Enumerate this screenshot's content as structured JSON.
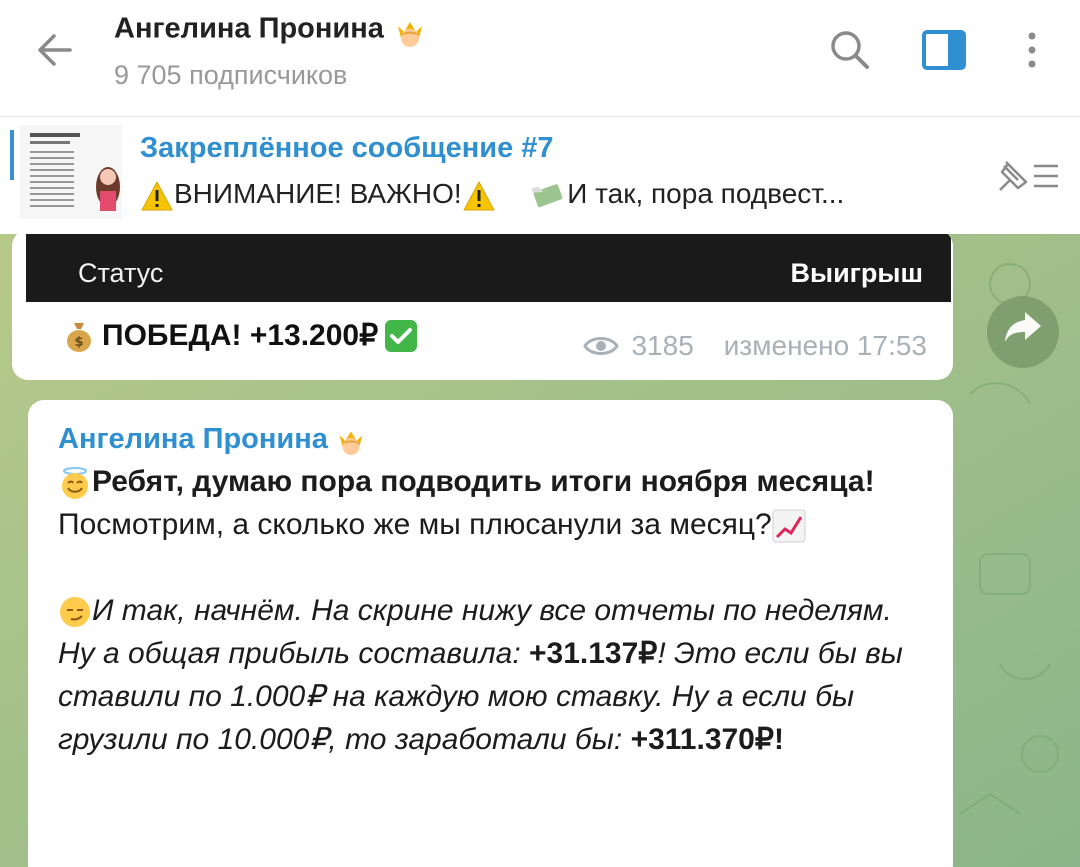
{
  "header": {
    "title": "Ангелина Пронина",
    "subscribers": "9 705 подписчиков",
    "icons": [
      "back-arrow-icon",
      "search-icon",
      "sidebar-toggle-icon",
      "more-vert-icon",
      "crown-emoji-icon"
    ]
  },
  "pinned": {
    "title": "Закреплённое сообщение #7",
    "warning1": "ВНИМАНИЕ! ВАЖНО!",
    "preview": "И так, пора подвест..."
  },
  "message1": {
    "col_left": "Статус",
    "col_right": "Выигрыш",
    "result": "ПОБЕДА! +13.200₽",
    "views": "3185",
    "edited": "изменено 17:53"
  },
  "message2": {
    "author": "Ангелина Пронина",
    "p1_bold": "Ребят, думаю пора подводить итоги ноября месяца!",
    "p1_rest": " Посмотрим, а сколько же мы плюсанули за месяц?",
    "p2_italic1": "И так, начнём. На скрине нижу все отчеты по неделям. Ну а общая прибыль составила: ",
    "p2_bold1": "+31.137₽",
    "p2_italic2": "! Это если бы вы ставили по 1.000₽ на каждую мою ставку. Ну а если бы грузили по 10.000₽, то заработали бы: ",
    "p2_bold2": "+311.370₽",
    "p2_end": "!"
  },
  "colors": {
    "accent": "#2f8fd0",
    "chat_bg": "#9ebd85",
    "dark_bar": "#1a1a1a",
    "meta": "#a8b0b8"
  }
}
